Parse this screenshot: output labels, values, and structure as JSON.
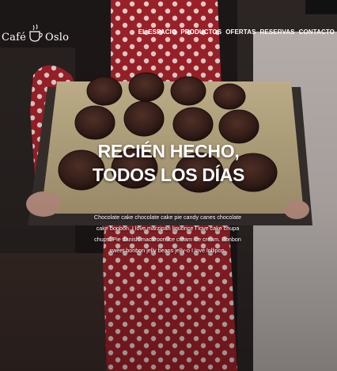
{
  "brand": {
    "word_left": "Café",
    "word_right": "Oslo"
  },
  "nav": {
    "items": [
      {
        "label": "EL ESPACIO"
      },
      {
        "label": "PRODUCTOS"
      },
      {
        "label": "OFERTAS"
      },
      {
        "label": "RESERVAS"
      },
      {
        "label": "CONTACTO"
      }
    ]
  },
  "hero": {
    "title": "RECIÉN HECHO, TODOS LOS DÍAS",
    "text": "Chocolate cake chocolate cake pie candy canes chocolate cake bonbon. I love marzipan liquorice I love cake chupa chups. Pie danish macaroon ice cream ice cream. Bonbon sweet bonbon jelly beans jelly-o I love lollipop."
  },
  "colors": {
    "accent_red": "#b3242b",
    "text": "#ffffff"
  },
  "icons": [
    "coffee-cup-icon"
  ]
}
